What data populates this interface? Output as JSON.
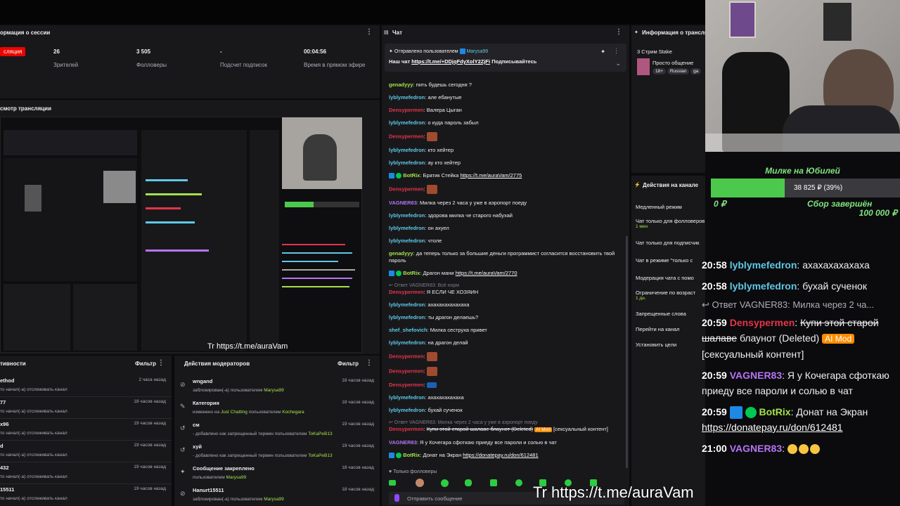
{
  "session": {
    "title": "ормация о сессии",
    "live_label": "сляция",
    "stats": [
      {
        "value": "26",
        "label": "Зрителей"
      },
      {
        "value": "3 505",
        "label": "Фолловеры"
      },
      {
        "value": "-",
        "label": "Подсчет подписок"
      },
      {
        "value": "00:04:56",
        "label": "Время в прямом эфире"
      }
    ]
  },
  "preview": {
    "title": "смотр трансляции",
    "watermark": "Tr https://t.me/auraVam"
  },
  "activity": {
    "title": "тивности",
    "filter": "Фильтр",
    "rows": [
      {
        "name": "ethod",
        "desc": "то начал(-а) отслеживать канал",
        "time": "2 часа назад"
      },
      {
        "name": "77",
        "desc": "то начал(-а) отслеживать канал",
        "time": "18 часов назад"
      },
      {
        "name": "x96",
        "desc": "то начал(-а) отслеживать канал",
        "time": "19 часов назад"
      },
      {
        "name": "d",
        "desc": "то начал(-а) отслеживать канал",
        "time": "19 часов назад"
      },
      {
        "name": "432",
        "desc": "то начал(-а) отслеживать канал",
        "time": "19 часов назад"
      },
      {
        "name": "15511",
        "desc": "то начал(-а) отслеживать канал",
        "time": "19 часов назад"
      }
    ]
  },
  "moderation": {
    "title": "Действия модераторов",
    "filter": "Фильтр",
    "rows": [
      {
        "icon": "ban-icon",
        "glyph": "⊘",
        "title": "wngand",
        "desc": "заблокирован(-а) пользователем",
        "who": "Marysa99",
        "time": "18 часов назад"
      },
      {
        "icon": "edit-icon",
        "glyph": "✎",
        "title": "Категория",
        "desc": "изменено на",
        "extra": "Just Chatting",
        "desc2": "пользователем",
        "who": "Kochegara",
        "time": "18 часов назад"
      },
      {
        "icon": "undo-icon",
        "glyph": "↺",
        "title": "см",
        "desc": "- добавлено как запрещенный термин пользователем",
        "who": "ToKaPeB13",
        "time": "19 часов назад"
      },
      {
        "icon": "undo-icon",
        "glyph": "↺",
        "title": "хуй",
        "desc": "- добавлено как запрещенный термин пользователем",
        "who": "ToKaPeB13",
        "time": "19 часов назад"
      },
      {
        "icon": "pin-icon",
        "glyph": "✦",
        "title": "Сообщение закреплено",
        "desc": "пользователем",
        "who": "Marysa99",
        "time": "18 часов назад"
      },
      {
        "icon": "ban-icon",
        "glyph": "⊘",
        "title": "Hanurt15511",
        "desc": "заблокирован(-а) пользователем",
        "who": "Marysa99",
        "time": "18 часов назад"
      }
    ]
  },
  "chat": {
    "title": "Чат",
    "pinned_by": "Отправлено пользователем",
    "pinned_user": "Marysa99",
    "pinned_msg_start": "Наш чат",
    "pinned_link": "https://t.me/+DDjqFdyXolY2ZjFi",
    "pinned_msg_end": "Подписывайтесь",
    "messages": [
      {
        "user": "genadyyy",
        "color": "#a5e14a",
        "text": "пить будешь сегодня ?"
      },
      {
        "user": "lyblymefedron",
        "color": "#5ec8e6",
        "text": "але ебанутые"
      },
      {
        "user": "Densypermen",
        "color": "#e5344a",
        "text": "Валера Цыган"
      },
      {
        "user": "lyblymefedron",
        "color": "#5ec8e6",
        "text": "о куда пароль забыл"
      },
      {
        "user": "Densypermen",
        "color": "#e5344a",
        "text": "",
        "emote": true
      },
      {
        "user": "lyblymefedron",
        "color": "#5ec8e6",
        "text": "кто хейтер"
      },
      {
        "user": "lyblymefedron",
        "color": "#5ec8e6",
        "text": "ау кто хейтер"
      },
      {
        "user": "BotRix",
        "color": "#a5e14a",
        "text": "Братик Стейка",
        "link": "https://t.me/auraVam/2775",
        "bot": true
      },
      {
        "user": "Densypermen",
        "color": "#e5344a",
        "text": "",
        "emote": true
      },
      {
        "user": "VAGNER83",
        "color": "#b574f5",
        "text": "Милка через 2 часа у уже в аэропорт поеду"
      },
      {
        "user": "lyblymefedron",
        "color": "#5ec8e6",
        "text": "здорова милка че старого набухай"
      },
      {
        "user": "lyblymefedron",
        "color": "#5ec8e6",
        "text": "он ахуел"
      },
      {
        "user": "lyblymefedron",
        "color": "#5ec8e6",
        "text": "чтоле"
      },
      {
        "user": "genadyyy",
        "color": "#a5e14a",
        "text": "да теперь только за большие деньги программист согласится восстановить твой пароль"
      },
      {
        "user": "BotRix",
        "color": "#a5e14a",
        "text": "Драгон мани",
        "link": "https://t.me/auraVam/2770",
        "bot": true
      },
      {
        "reply": "Ответ VAGNER83: Всё норм",
        "user": "Densypermen",
        "color": "#e5344a",
        "text": "Я ЕСЛИ ЧЕ ХОЗЯИН"
      },
      {
        "user": "lyblymefedron",
        "color": "#5ec8e6",
        "text": "ахахахахахахаха"
      },
      {
        "user": "lyblymefedron",
        "color": "#5ec8e6",
        "text": "ты драгон делаешь?"
      },
      {
        "user": "shef_shefovich",
        "color": "#5ec8e6",
        "text": "Милка сеструха привет"
      },
      {
        "user": "lyblymefedron",
        "color": "#5ec8e6",
        "text": "на драгон делай"
      },
      {
        "user": "Densypermen",
        "color": "#e5344a",
        "text": "",
        "emote": true
      },
      {
        "user": "Densypermen",
        "color": "#e5344a",
        "text": "",
        "emote": true
      },
      {
        "user": "Densypermen",
        "color": "#e5344a",
        "text": "",
        "emote_blue": true
      },
      {
        "user": "lyblymefedron",
        "color": "#5ec8e6",
        "text": "ахахахахахаха"
      },
      {
        "user": "lyblymefedron",
        "color": "#5ec8e6",
        "text": "бухай сученок"
      },
      {
        "reply": "Ответ VAGNER83: Милка через 2 часа у уже в аэропорт поеду",
        "user": "Densypermen",
        "color": "#e5344a",
        "text": "Купи этой старой шалаве блаунот (Deleted)",
        "strike": true,
        "aimod": "AI Mod",
        "tail": "[сексуальный контент]"
      },
      {
        "user": "VAGNER83",
        "color": "#b574f5",
        "text": "Я у Кочегара сфоткаю приеду все пароли и солью в чат"
      },
      {
        "user": "BotRix",
        "color": "#a5e14a",
        "text": "Донат на Экран",
        "link": "https://donatepay.ru/don/612481",
        "bot": true
      },
      {
        "user": "VAGNER83",
        "color": "#b574f5",
        "text": "🤣 🤣 🤣"
      }
    ],
    "followers_only": "Только фолловеры",
    "input_placeholder": "Отправить сообщение"
  },
  "stream_info": {
    "title": "Информация о трансля",
    "stream_name": "3 Стрим Stake",
    "category": "Просто общение",
    "tags": [
      "18+",
      "Russian",
      "ga"
    ]
  },
  "channel_actions": {
    "title": "Действия на канале",
    "items": [
      {
        "label": "Медленный режим"
      },
      {
        "label": "Чат только для фолловеров",
        "sub": "1 мин"
      },
      {
        "label": "Чат только для подписчик"
      },
      {
        "label": "Чат в режиме \"только с"
      },
      {
        "label": "Модерация чата с помо"
      },
      {
        "label": "Ограничение по возраст",
        "sub": "1 дн."
      },
      {
        "label": "Запрещенные слова"
      },
      {
        "label": "Перейти на канал"
      },
      {
        "label": "Установить цели"
      }
    ]
  },
  "goal": {
    "title": "Милке на Юбилей",
    "amount": "38 825 ₽ (39%)",
    "progress": 0.39,
    "start": "0 ₽",
    "status": "Сбор завершён",
    "target": "100 000 ₽"
  },
  "overlay_chat": {
    "lines": [
      {
        "time": "20:58",
        "user": "lyblymefedron",
        "color": "#5ec8e6",
        "text": "ахахахахахаха"
      },
      {
        "time": "20:58",
        "user": "lyblymefedron",
        "color": "#5ec8e6",
        "text": "бухай сученок"
      },
      {
        "reply": "Ответ VAGNER83: Милка через 2 ча..."
      },
      {
        "time": "20:59",
        "user": "Densypermen",
        "color": "#e5344a",
        "text": "Купи этой старой шалаве",
        "strike": true,
        "text2": "блаунот (Deleted)",
        "aimod": "AI Mod",
        "tail": "[сексуальный контент]"
      },
      {
        "time": "20:59",
        "user": "VAGNER83",
        "color": "#b574f5",
        "text": "Я у Кочегара сфоткаю приеду все пароли и солью в чат"
      },
      {
        "time": "20:59",
        "user": "BotRix",
        "color": "#a5e14a",
        "text": "Донат на Экран",
        "link": "https://donatepay.ru/don/612481",
        "bot": true
      },
      {
        "time": "21:00",
        "user": "VAGNER83",
        "color": "#b574f5",
        "text": "",
        "emojis": 3
      }
    ]
  },
  "watermark": "Tr https://t.me/auraVam",
  "colors": {
    "panel": "#18181b",
    "live": "#eb0400",
    "goal_bar": "#4cc84c",
    "accent_green": "#a5e14a"
  }
}
